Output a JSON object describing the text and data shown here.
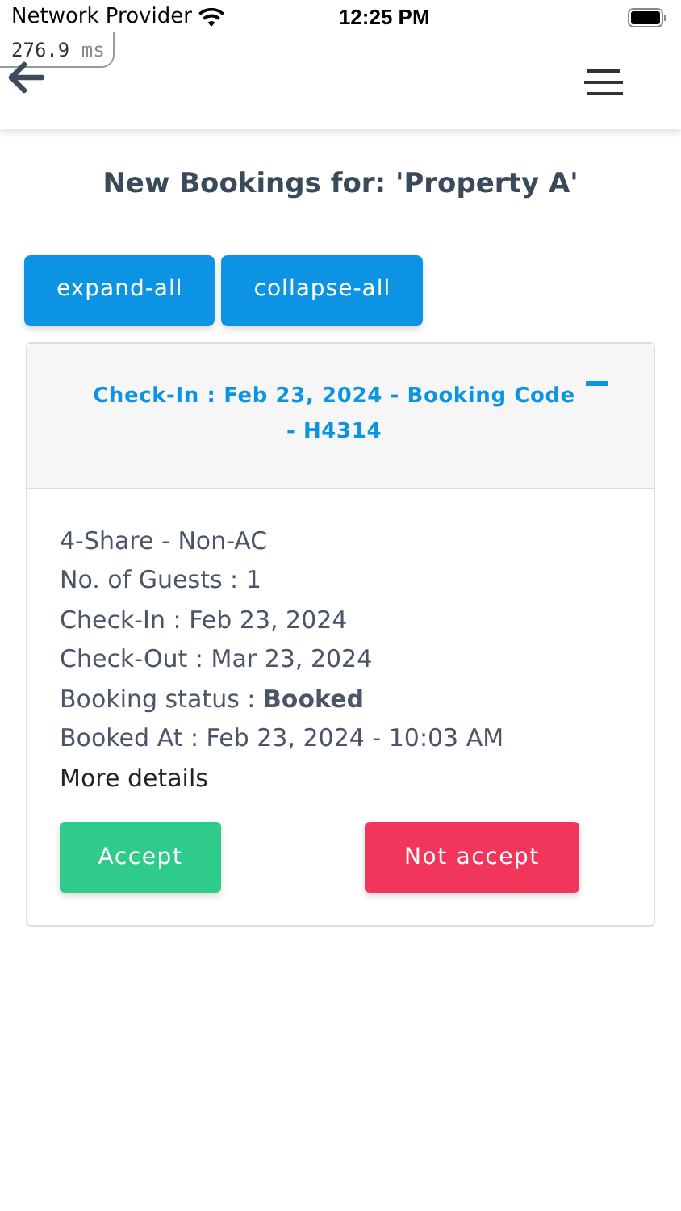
{
  "status_bar": {
    "carrier": "Network Provider",
    "time": "12:25 PM"
  },
  "timing_badge": {
    "value": "276.9",
    "unit": "ms"
  },
  "page_title": "New Bookings for: 'Property A'",
  "toolbar_buttons": [
    "expand-all",
    "collapse-all"
  ],
  "bookings": [
    {
      "header": "Check-In : Feb 23, 2024 - Booking Code - H4314",
      "expanded": true,
      "details": [
        "4-Share - Non-AC",
        "No. of Guests : 1",
        "Check-In : Feb 23, 2024",
        "Check-Out : Mar 23, 2024",
        "Booking status : **Booked**",
        "Booked At : Feb 23, 2024 - 10:03 AM"
      ],
      "link": "More details",
      "actions": [
        {
          "label": "Accept",
          "kind": "accept"
        },
        {
          "label": "Not accept",
          "kind": "reject"
        }
      ]
    }
  ]
}
